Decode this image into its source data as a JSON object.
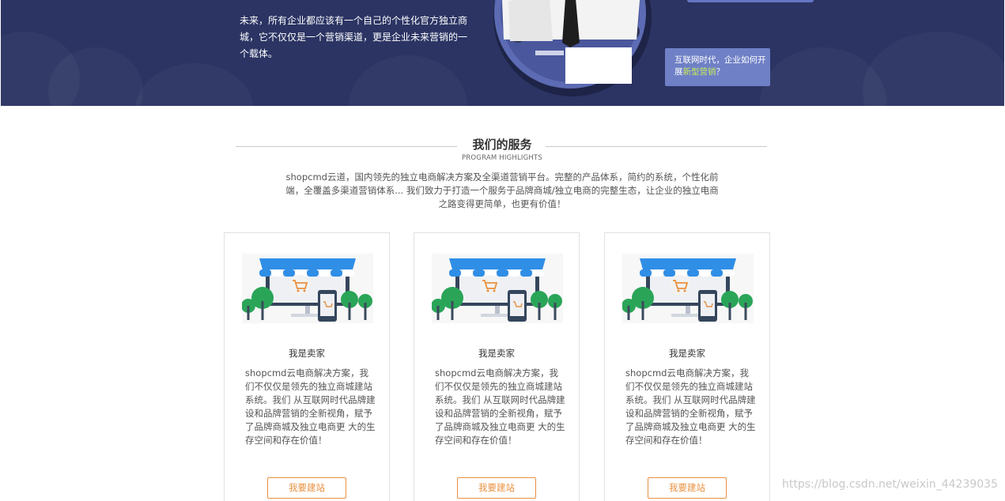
{
  "hero": {
    "text": "未来，所有企业都应该有一个自己的个性化官方独立商城，它不仅仅是一个营销渠道，更是企业未来营销的一个载体。",
    "bubble_prefix": "互联网时代，企业如何开展",
    "bubble_highlight": "新型营销",
    "bubble_suffix": "？",
    "colors": {
      "background": "#2b3463",
      "bubble": "#6f80c6",
      "highlight": "#c8ec5c"
    }
  },
  "services": {
    "title": "我们的服务",
    "subtitle": "PROGRAM HIGHLIGHTS",
    "description": "shopcmd云道，国内领先的独立电商解决方案及全渠道营销平台。完整的产品体系，简约的系统，个性化前端，全覆盖多渠道营销体系... 我们致力于打造一个服务于品牌商城/独立电商的完整生态，让企业的独立电商之路变得更简单，也更有价值！",
    "cards": [
      {
        "illustration": "storefront-illustration",
        "title": "我是卖家",
        "description": "shopcmd云电商解决方案，我们不仅仅是领先的独立商城建站系统。我们 从互联网时代品牌建设和品牌营销的全新视角，赋予了品牌商城及独立电商更 大的生存空间和存在价值！",
        "button": "我要建站"
      },
      {
        "illustration": "storefront-illustration",
        "title": "我是卖家",
        "description": "shopcmd云电商解决方案，我们不仅仅是领先的独立商城建站系统。我们 从互联网时代品牌建设和品牌营销的全新视角，赋予了品牌商城及独立电商更 大的生存空间和存在价值！",
        "button": "我要建站"
      },
      {
        "illustration": "storefront-illustration",
        "title": "我是卖家",
        "description": "shopcmd云电商解决方案，我们不仅仅是领先的独立商城建站系统。我们 从互联网时代品牌建设和品牌营销的全新视角，赋予了品牌商城及独立电商更 大的生存空间和存在价值！",
        "button": "我要建站"
      }
    ],
    "colors": {
      "accent": "#e9903f",
      "awning": "#2f8ee6"
    }
  },
  "watermark": "https://blog.csdn.net/weixin_44239035"
}
